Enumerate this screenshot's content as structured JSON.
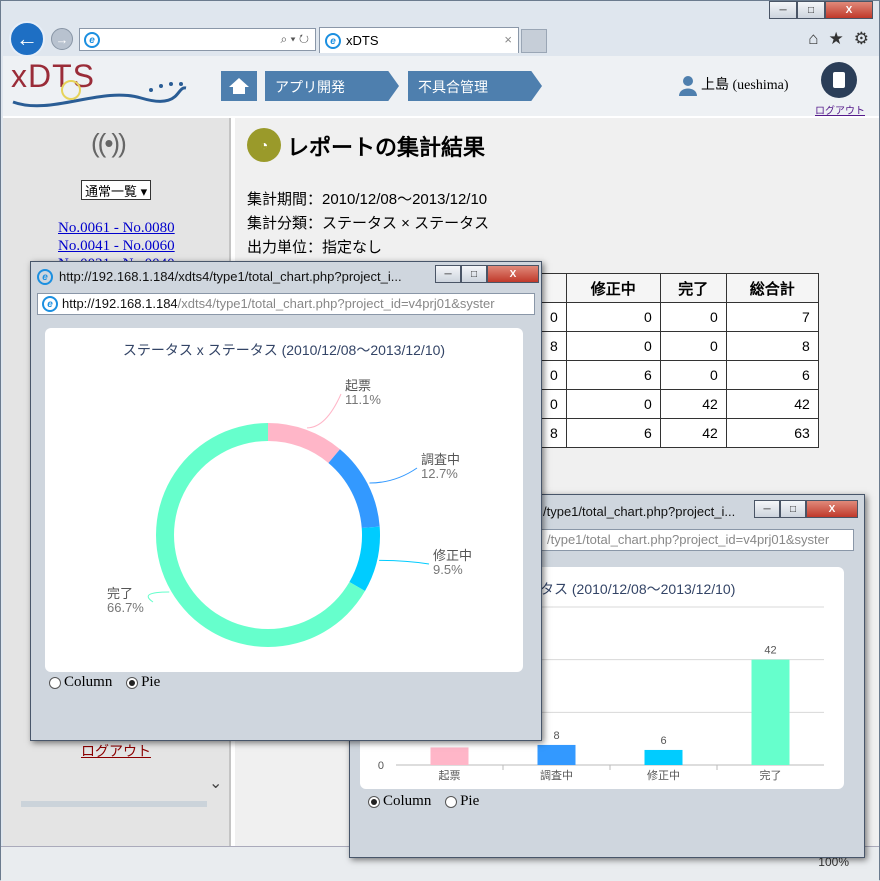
{
  "browser": {
    "tab_title": "xDTS",
    "tab_close": "×",
    "minimize": "─",
    "maximize": "□",
    "close": "X",
    "back": "←",
    "forward": "→",
    "address_icons": "⌕ ▾ ↻",
    "toolbar_icons": {
      "home": "⌂",
      "favorites": "★",
      "settings": "⚙"
    }
  },
  "app": {
    "logo": "xDTS",
    "breadcrumbs": [
      "アプリ開発",
      "不具合管理"
    ],
    "user_name": "上島 (ueshima)",
    "logout_top": "ログアウト"
  },
  "sidebar": {
    "select_value": "通常一覧",
    "range_links": [
      "No.0061 - No.0080",
      "No.0041 - No.0060",
      "No.0021 - No.0040"
    ],
    "logout": "ログアウト",
    "scroll_down": "⌄"
  },
  "report": {
    "title": "レポートの集計結果",
    "period": "集計期間：2010/12/08〜2013/12/10",
    "category": "集計分類：ステータス × ステータス",
    "unit": "出力単位：指定なし",
    "table": {
      "headers": [
        "修正中",
        "完了",
        "総合計"
      ],
      "first_col_partial": [
        "0",
        "8",
        "0",
        "0",
        "8"
      ],
      "rows": [
        [
          "0",
          "0",
          "7"
        ],
        [
          "0",
          "0",
          "8"
        ],
        [
          "6",
          "0",
          "6"
        ],
        [
          "0",
          "42",
          "42"
        ],
        [
          "6",
          "42",
          "63"
        ]
      ]
    }
  },
  "pie_popup": {
    "title": "http://192.168.1.184/xdts4/type1/total_chart.php?project_i...",
    "url_host": "http://192.168.1.184",
    "url_path": "/xdts4/type1/total_chart.php?project_id=v4prj01&syster",
    "chart_title": "ステータス x ステータス (2010/12/08〜2013/12/10)",
    "radio_column": "Column",
    "radio_pie": "Pie"
  },
  "column_popup": {
    "title": "/type1/total_chart.php?project_i...",
    "url_path": "/type1/total_chart.php?project_id=v4prj01&syster",
    "chart_title": "タス (2010/12/08〜2013/12/10)",
    "radio_column": "Column",
    "radio_pie": "Pie"
  },
  "status": {
    "zoom": "100%"
  },
  "chart_data": [
    {
      "type": "pie",
      "title": "ステータス x ステータス (2010/12/08〜2013/12/10)",
      "donut": true,
      "slices": [
        {
          "label": "起票",
          "value": 7,
          "percent": "11.1%",
          "color": "#ffb6c8"
        },
        {
          "label": "調査中",
          "value": 8,
          "percent": "12.7%",
          "color": "#3399ff"
        },
        {
          "label": "修正中",
          "value": 6,
          "percent": "9.5%",
          "color": "#00ccff"
        },
        {
          "label": "完了",
          "value": 42,
          "percent": "66.7%",
          "color": "#66ffcc"
        }
      ]
    },
    {
      "type": "bar",
      "title": "タス (2010/12/08〜2013/12/10)",
      "categories": [
        "起票",
        "調査中",
        "修正中",
        "完了"
      ],
      "values": [
        7,
        8,
        6,
        42
      ],
      "data_labels": [
        "",
        "8",
        "6",
        "42"
      ],
      "colors": [
        "#ffb6c8",
        "#3399ff",
        "#00ccff",
        "#66ffcc"
      ],
      "ylim": [
        0,
        63
      ],
      "y_tick_labels": [
        "0"
      ],
      "grid": true
    }
  ]
}
